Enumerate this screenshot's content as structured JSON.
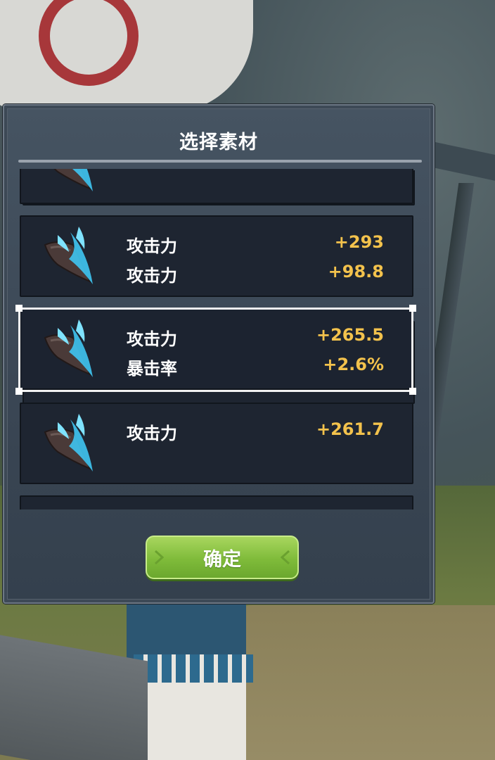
{
  "dialog": {
    "title": "选择素材",
    "confirm_label": "确定"
  },
  "materials": [
    {
      "stats": []
    },
    {
      "stats": [
        {
          "label": "攻击力",
          "value": "+293"
        },
        {
          "label": "攻击力",
          "value": "+98.8"
        }
      ]
    },
    {
      "selected": true,
      "stats": [
        {
          "label": "攻击力",
          "value": "+265.5"
        },
        {
          "label": "暴击率",
          "value": "+2.6%"
        }
      ]
    },
    {
      "stats": [
        {
          "label": "攻击力",
          "value": "+261.7"
        }
      ]
    },
    {
      "stats": []
    }
  ],
  "colors": {
    "stat_value": "#f3c24c",
    "confirm_button": "#8cc63f",
    "panel": "#3a4654",
    "card": "#1e2531"
  }
}
